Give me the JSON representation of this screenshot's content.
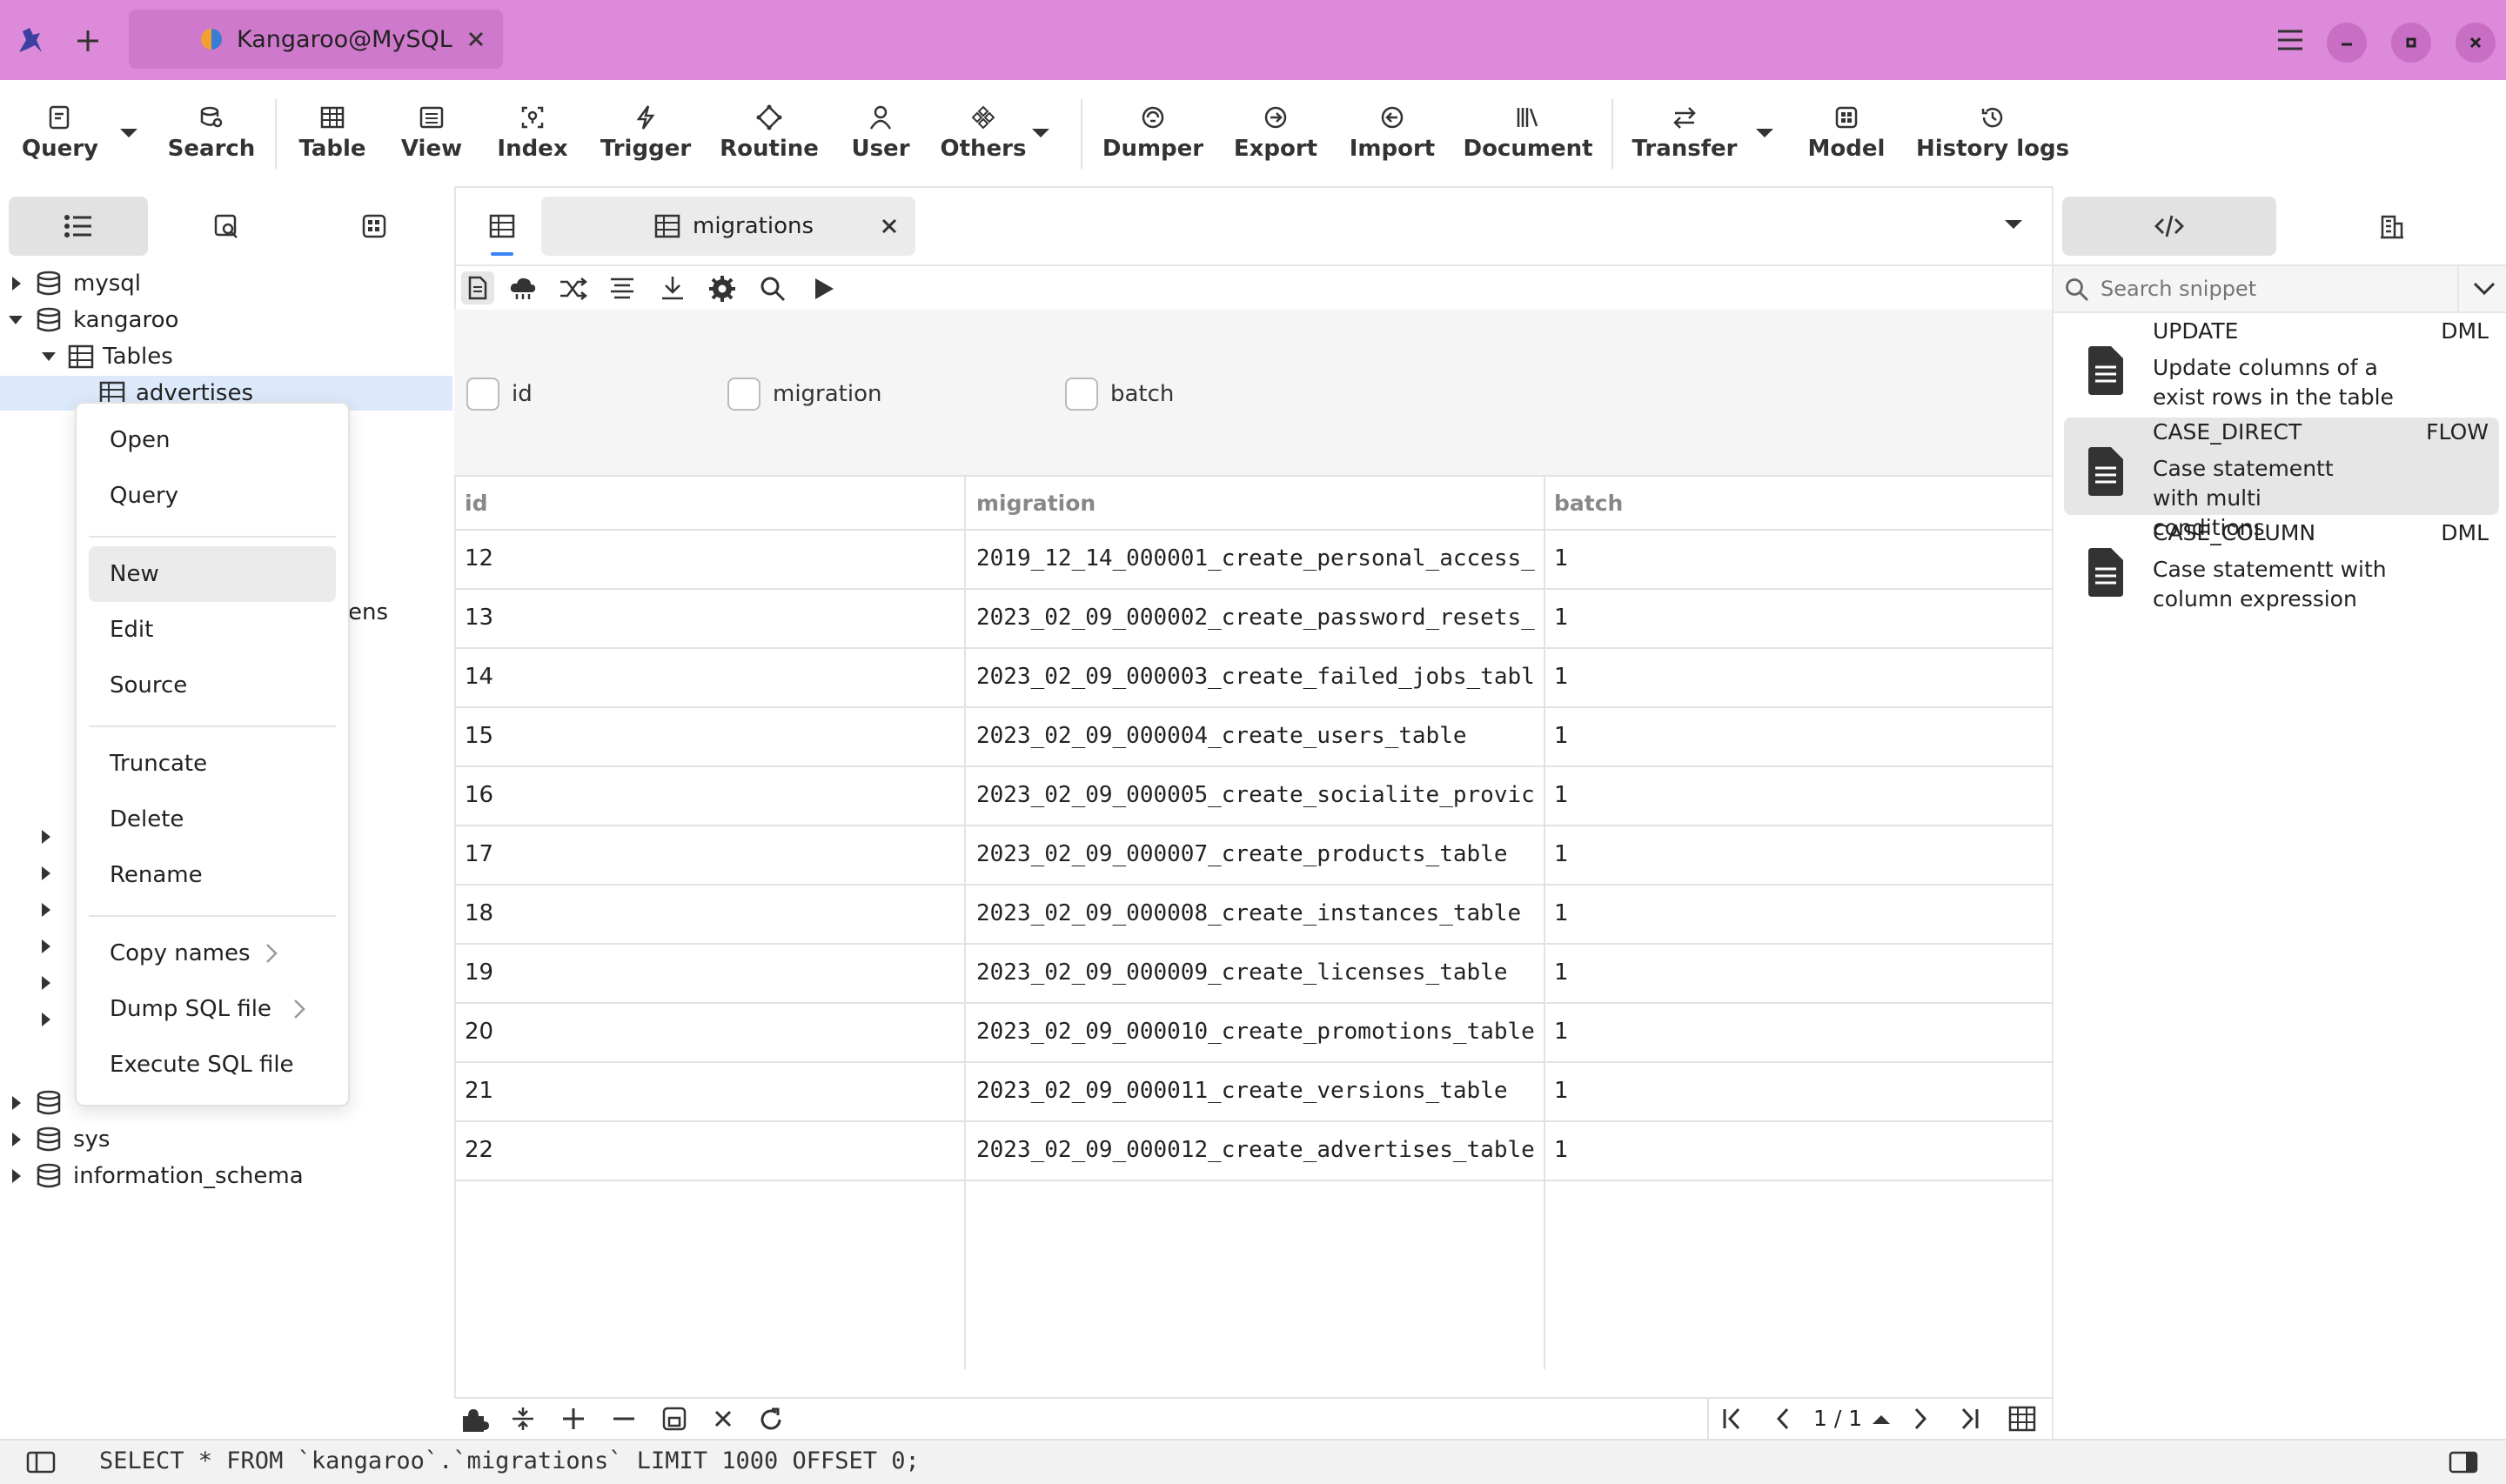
{
  "titlebar": {
    "tab_title": "Kangaroo@MySQL"
  },
  "toolbar": {
    "items": [
      {
        "label": "Query",
        "icon": "query-icon"
      },
      {
        "label": "Search",
        "icon": "search-db-icon"
      },
      {
        "label": "Table",
        "icon": "table-icon"
      },
      {
        "label": "View",
        "icon": "view-icon"
      },
      {
        "label": "Index",
        "icon": "index-icon"
      },
      {
        "label": "Trigger",
        "icon": "trigger-icon"
      },
      {
        "label": "Routine",
        "icon": "routine-icon"
      },
      {
        "label": "User",
        "icon": "user-icon"
      },
      {
        "label": "Others",
        "icon": "others-icon"
      },
      {
        "label": "Dumper",
        "icon": "dumper-icon"
      },
      {
        "label": "Export",
        "icon": "export-icon"
      },
      {
        "label": "Import",
        "icon": "import-icon"
      },
      {
        "label": "Document",
        "icon": "document-icon"
      },
      {
        "label": "Transfer",
        "icon": "transfer-icon"
      },
      {
        "label": "Model",
        "icon": "model-icon"
      },
      {
        "label": "History logs",
        "icon": "history-icon"
      }
    ]
  },
  "sidebar": {
    "tree": [
      {
        "label": "mysql"
      },
      {
        "label": "kangaroo"
      },
      {
        "label": "Tables"
      },
      {
        "label": "advertises"
      },
      {
        "label": "sys"
      },
      {
        "label": "information_schema"
      }
    ],
    "partial_label": "ens"
  },
  "context_menu": {
    "items": [
      {
        "label": "Open"
      },
      {
        "label": "Query"
      },
      {
        "label": "New"
      },
      {
        "label": "Edit"
      },
      {
        "label": "Source"
      },
      {
        "label": "Truncate"
      },
      {
        "label": "Delete"
      },
      {
        "label": "Rename"
      },
      {
        "label": "Copy names"
      },
      {
        "label": "Dump SQL file"
      },
      {
        "label": "Execute SQL file"
      }
    ]
  },
  "editor": {
    "tab_title": "migrations",
    "filters": [
      "id",
      "migration",
      "batch"
    ],
    "columns": [
      "id",
      "migration",
      "batch"
    ],
    "rows": [
      {
        "id": "12",
        "migration": "2019_12_14_000001_create_personal_access_",
        "batch": "1"
      },
      {
        "id": "13",
        "migration": "2023_02_09_000002_create_password_resets_",
        "batch": "1"
      },
      {
        "id": "14",
        "migration": "2023_02_09_000003_create_failed_jobs_tabl",
        "batch": "1"
      },
      {
        "id": "15",
        "migration": "2023_02_09_000004_create_users_table",
        "batch": "1"
      },
      {
        "id": "16",
        "migration": "2023_02_09_000005_create_socialite_provic",
        "batch": "1"
      },
      {
        "id": "17",
        "migration": "2023_02_09_000007_create_products_table",
        "batch": "1"
      },
      {
        "id": "18",
        "migration": "2023_02_09_000008_create_instances_table",
        "batch": "1"
      },
      {
        "id": "19",
        "migration": "2023_02_09_000009_create_licenses_table",
        "batch": "1"
      },
      {
        "id": "20",
        "migration": "2023_02_09_000010_create_promotions_table",
        "batch": "1"
      },
      {
        "id": "21",
        "migration": "2023_02_09_000011_create_versions_table",
        "batch": "1"
      },
      {
        "id": "22",
        "migration": "2023_02_09_000012_create_advertises_table",
        "batch": "1"
      }
    ],
    "pagination": "1 / 1"
  },
  "statusbar": {
    "sql": "SELECT * FROM `kangaroo`.`migrations` LIMIT 1000 OFFSET 0;"
  },
  "right_panel": {
    "search_placeholder": "Search snippet",
    "snippets": [
      {
        "name": "UPDATE",
        "category": "DML",
        "desc": "Update columns of a exist rows in the table"
      },
      {
        "name": "CASE_DIRECT",
        "category": "FLOW",
        "desc": "Case statementt with multi conditions"
      },
      {
        "name": "CASE_COLUMN",
        "category": "DML",
        "desc": "Case statementt with column expression"
      }
    ]
  },
  "colors": {
    "titlebar": "#dc8ad9",
    "active_tab": "#cf79cc",
    "selection": "#dbe9fb"
  }
}
